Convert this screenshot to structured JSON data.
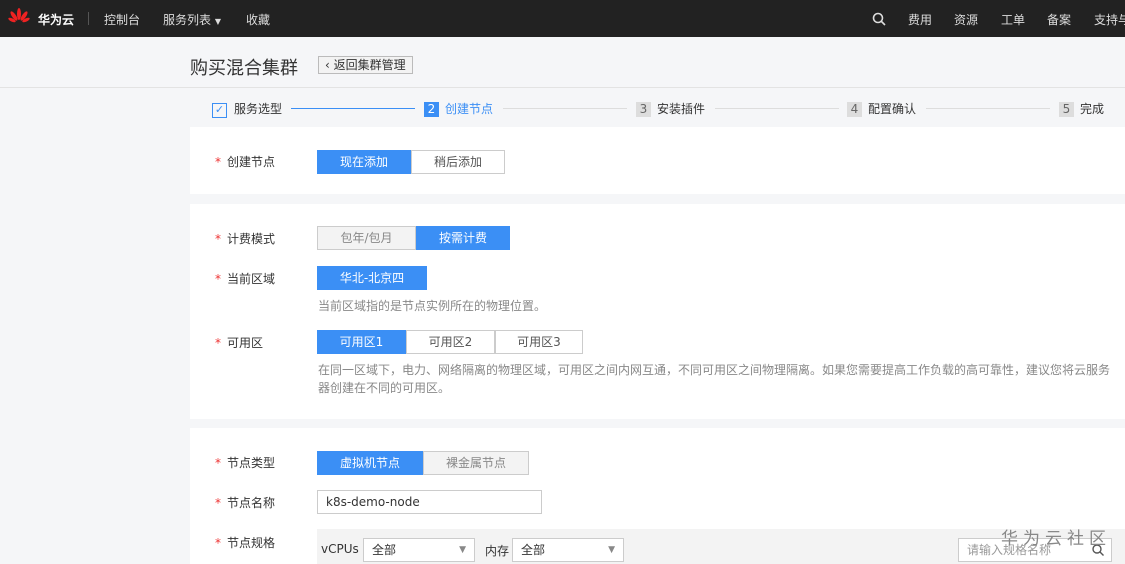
{
  "topbar": {
    "brand": "华为云",
    "nav": [
      "控制台",
      "服务列表",
      "收藏"
    ],
    "right": [
      "费用",
      "资源",
      "工单",
      "备案",
      "支持与"
    ],
    "logo_text": "HUAWEI"
  },
  "page": {
    "title": "购买混合集群",
    "back": "返回集群管理"
  },
  "steps": [
    {
      "num": "1",
      "label": "服务选型",
      "state": "done"
    },
    {
      "num": "2",
      "label": "创建节点",
      "state": "active"
    },
    {
      "num": "3",
      "label": "安装插件",
      "state": "pending"
    },
    {
      "num": "4",
      "label": "配置确认",
      "state": "pending"
    },
    {
      "num": "5",
      "label": "完成",
      "state": "pending"
    }
  ],
  "create_node": {
    "label": "创建节点",
    "options": [
      "现在添加",
      "稍后添加"
    ],
    "selected": "现在添加"
  },
  "billing": {
    "label": "计费模式",
    "options": [
      "包年/包月",
      "按需计费"
    ],
    "selected": "按需计费"
  },
  "region": {
    "label": "当前区域",
    "value": "华北-北京四",
    "hint": "当前区域指的是节点实例所在的物理位置。"
  },
  "az": {
    "label": "可用区",
    "options": [
      "可用区1",
      "可用区2",
      "可用区3"
    ],
    "selected": "可用区1",
    "hint": "在同一区域下，电力、网络隔离的物理区域，可用区之间内网互通，不同可用区之间物理隔离。如果您需要提高工作负载的高可靠性，建议您将云服务器创建在不同的可用区。"
  },
  "node_type": {
    "label": "节点类型",
    "options": [
      "虚拟机节点",
      "裸金属节点"
    ],
    "selected": "虚拟机节点"
  },
  "node_name": {
    "label": "节点名称",
    "value": "k8s-demo-node"
  },
  "node_spec": {
    "label": "节点规格",
    "vcpus_label": "vCPUs",
    "vcpus_value": "全部",
    "mem_label": "内存",
    "mem_value": "全部",
    "search_placeholder": "请输入规格名称"
  },
  "watermark": "华为云社区",
  "colors": {
    "accent": "#3b8ff5",
    "topbar": "#222222",
    "required": "#ee3333"
  }
}
